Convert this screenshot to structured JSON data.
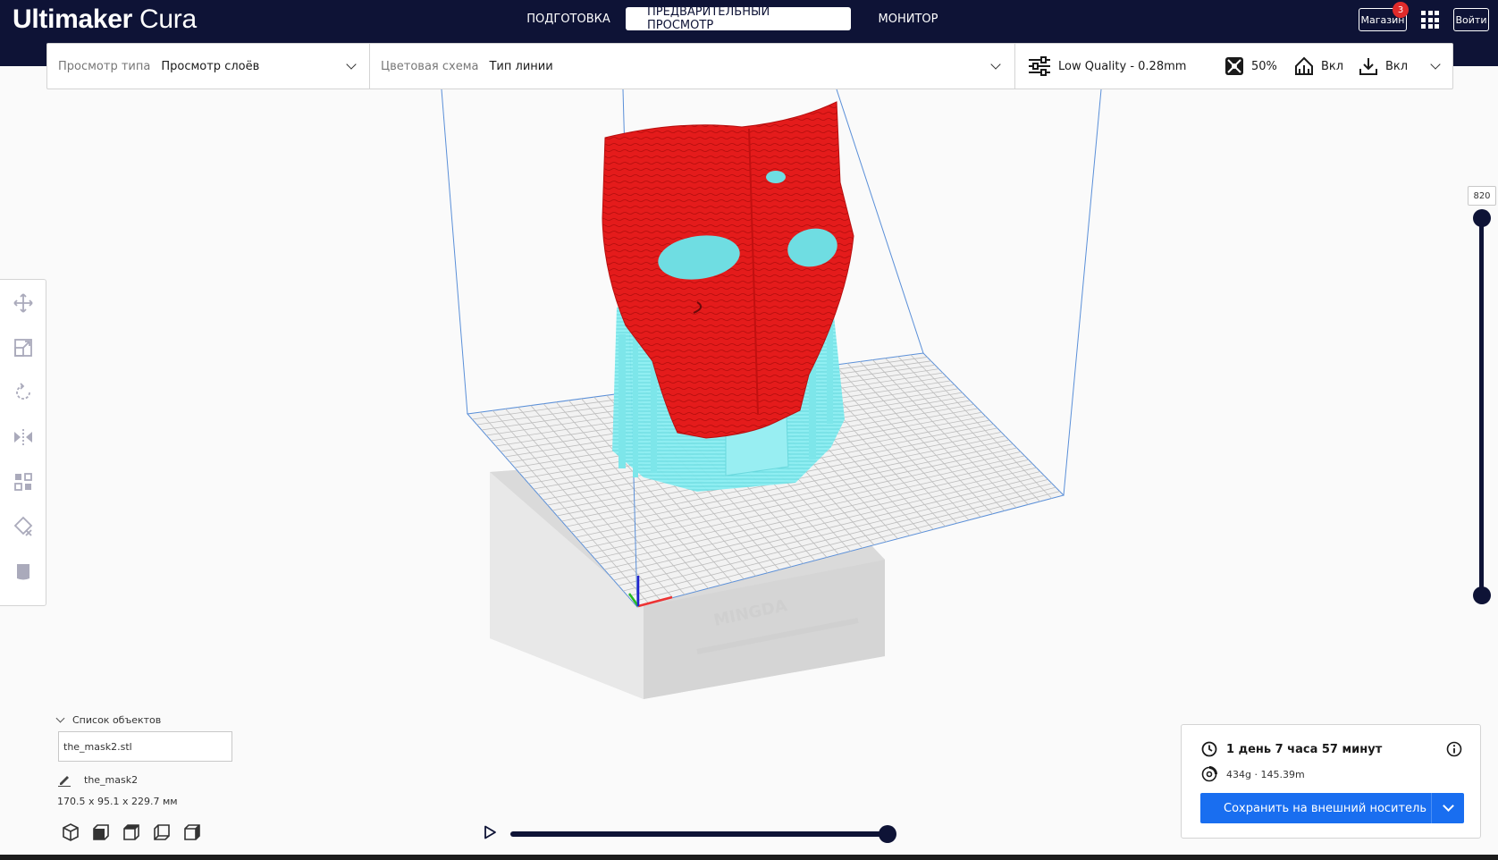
{
  "app": {
    "title_bold": "Ultimaker",
    "title_light": "Cura"
  },
  "stages": [
    {
      "label": "ПОДГОТОВКА"
    },
    {
      "label": "ПРЕДВАРИТЕЛЬНЫЙ ПРОСМОТР"
    },
    {
      "label": "МОНИТОР"
    }
  ],
  "header": {
    "marketplace_label": "Магазин",
    "marketplace_badge": "3",
    "signin_label": "Войти"
  },
  "settings_bar": {
    "view_type_label": "Просмотр типа",
    "view_type_value": "Просмотр слоёв",
    "color_scheme_label": "Цветовая схема",
    "color_scheme_value": "Тип линии",
    "profile": "Low Quality - 0.28mm",
    "infill": "50%",
    "support": "Вкл",
    "adhesion": "Вкл"
  },
  "layer_slider": {
    "max_layer": "820"
  },
  "object_list": {
    "header": "Список объектов",
    "file": "the_mask2.stl",
    "object_name": "the_mask2",
    "dimensions": "170.5 x 95.1 x 229.7 мм"
  },
  "print_info": {
    "time": "1 день 7 часа 57 минут",
    "material": "434g · 145.39m",
    "save_label": "Сохранить на внешний носитель"
  },
  "printer_brand": "MINGDA",
  "colors": {
    "header": "#0e1336",
    "accent": "#196ef0",
    "wall": "#e51a1a",
    "support": "#5fe3e8"
  },
  "icons": {
    "toolbar": [
      "move-icon",
      "scale-icon",
      "rotate-icon",
      "mirror-icon",
      "per-model-settings-icon",
      "support-blocker-icon",
      "cylinder-icon"
    ],
    "view_orientation": [
      "3d-view-icon",
      "front-view-icon",
      "top-view-icon",
      "left-view-icon",
      "right-view-icon"
    ]
  }
}
